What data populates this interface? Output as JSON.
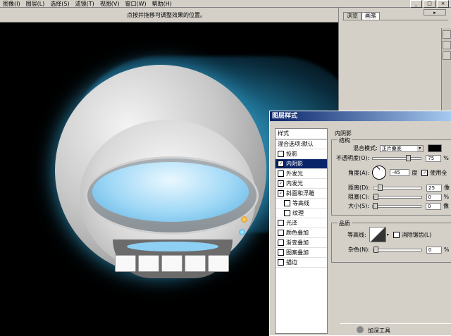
{
  "menu": [
    "图像(I)",
    "图层(L)",
    "选择(S)",
    "滤镜(T)",
    "视图(V)",
    "窗口(W)",
    "帮助(H)"
  ],
  "options_hint": "点按并拖移可调整效果的位置。",
  "window_buttons": [
    "_",
    "□",
    "×"
  ],
  "palette": {
    "tabs": [
      "浏览",
      "画笔"
    ],
    "button": "▸"
  },
  "dialog": {
    "title": "图层样式",
    "styles_header": "样式",
    "blend_default": "混合选项:默认",
    "items": [
      {
        "label": "投影",
        "checked": false
      },
      {
        "label": "内阴影",
        "checked": true,
        "selected": true
      },
      {
        "label": "外发光",
        "checked": false
      },
      {
        "label": "内发光",
        "checked": true
      },
      {
        "label": "斜面和浮雕",
        "checked": true
      },
      {
        "label": "等高线",
        "checked": false,
        "indent": true
      },
      {
        "label": "纹理",
        "checked": false,
        "indent": true
      },
      {
        "label": "光泽",
        "checked": false
      },
      {
        "label": "颜色叠加",
        "checked": false
      },
      {
        "label": "渐变叠加",
        "checked": false
      },
      {
        "label": "图案叠加",
        "checked": false
      },
      {
        "label": "描边",
        "checked": false
      }
    ],
    "section_title": "内阴影",
    "structure_title": "结构",
    "blend_mode_label": "混合模式:",
    "blend_mode_value": "正片叠底",
    "opacity_label": "不透明度(O):",
    "opacity_value": "75",
    "opacity_fraction": 0.75,
    "angle_label": "角度(A):",
    "angle_value": "-45",
    "angle_unit": "度",
    "global_light_label": "使用全",
    "distance_label": "距离(D):",
    "distance_value": "25",
    "distance_fraction": 0.1,
    "choke_label": "阻塞(C):",
    "choke_value": "0",
    "size_label": "大小(S):",
    "size_value": "0",
    "percent": "%",
    "px_unit": "像",
    "quality_title": "品质",
    "contour_label": "等高线:",
    "antialias_label": "消除锯齿(L)",
    "noise_label": "杂色(N):",
    "noise_value": "0"
  },
  "taskbar": {
    "label": "加深工具"
  }
}
